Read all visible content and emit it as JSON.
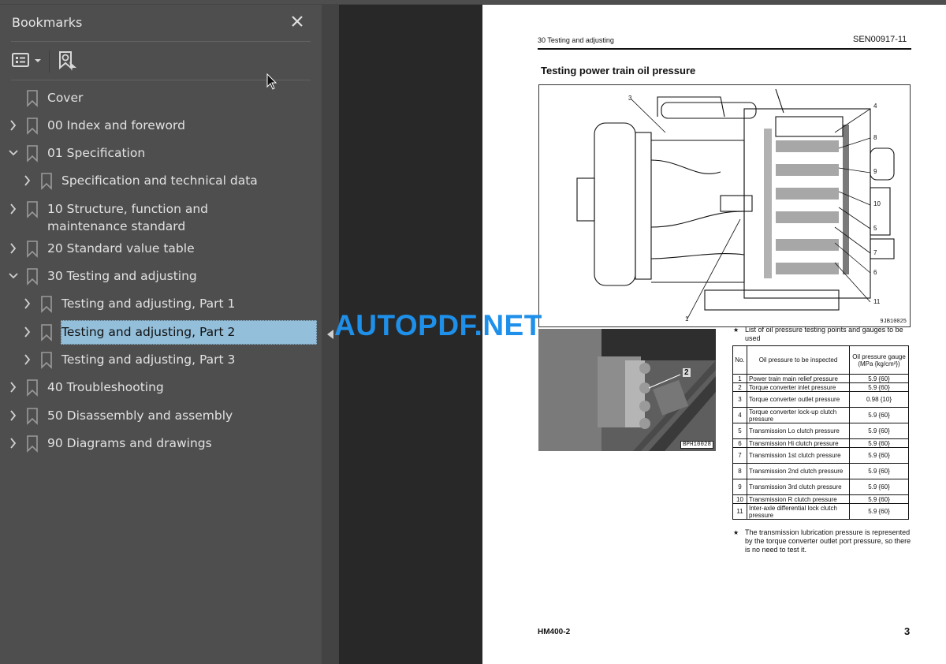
{
  "bookmarks_panel": {
    "title": "Bookmarks",
    "close_label": "close",
    "toolbar": {
      "options_icon": "list-options-icon",
      "find_current_icon": "find-current-bookmark-icon"
    },
    "items": [
      {
        "label": "Cover",
        "level": 0,
        "expander": "none"
      },
      {
        "label": "00 Index and foreword",
        "level": 0,
        "expander": "collapsed"
      },
      {
        "label": "01 Specification",
        "level": 0,
        "expander": "expanded"
      },
      {
        "label": "Specification and technical data",
        "level": 1,
        "expander": "collapsed"
      },
      {
        "label": "10 Structure, function and maintenance standard",
        "level": 0,
        "expander": "collapsed"
      },
      {
        "label": "20 Standard value table",
        "level": 0,
        "expander": "collapsed"
      },
      {
        "label": "30 Testing and adjusting",
        "level": 0,
        "expander": "expanded"
      },
      {
        "label": "Testing and adjusting, Part 1",
        "level": 1,
        "expander": "collapsed"
      },
      {
        "label": "Testing and adjusting, Part 2",
        "level": 1,
        "expander": "collapsed",
        "selected": true
      },
      {
        "label": "Testing and adjusting, Part 3",
        "level": 1,
        "expander": "collapsed"
      },
      {
        "label": "40 Troubleshooting",
        "level": 0,
        "expander": "collapsed"
      },
      {
        "label": "50 Disassembly and assembly",
        "level": 0,
        "expander": "collapsed"
      },
      {
        "label": "90 Diagrams and drawings",
        "level": 0,
        "expander": "collapsed"
      }
    ]
  },
  "watermark": "AUTOPDF.NET",
  "page": {
    "header_left": "30 Testing and adjusting",
    "header_right": "SEN00917-11",
    "title": "Testing power train oil pressure",
    "figure_code": "9JB10025",
    "figure_callouts": [
      "3",
      "4",
      "8",
      "9",
      "10",
      "5",
      "7",
      "6",
      "11",
      "1"
    ],
    "photo_code": "BPH10028",
    "photo_callout": "2",
    "list_note": "List of oil pressure testing points and gauges to be used",
    "table": {
      "headers": [
        "No.",
        "Oil pressure to be inspected",
        "Oil pressure gauge (MPa {kg/cm²})"
      ],
      "rows": [
        [
          "1",
          "Power train main relief pressure",
          "5.9 {60}"
        ],
        [
          "2",
          "Torque converter inlet pressure",
          "5.9 {60}"
        ],
        [
          "3",
          "Torque converter outlet pressure",
          "0.98 {10}"
        ],
        [
          "4",
          "Torque converter lock-up clutch pressure",
          "5.9 {60}"
        ],
        [
          "5",
          "Transmission Lo clutch pressure",
          "5.9 {60}"
        ],
        [
          "6",
          "Transmission Hi clutch pressure",
          "5.9 {60}"
        ],
        [
          "7",
          "Transmission 1st clutch pressure",
          "5.9 {60}"
        ],
        [
          "8",
          "Transmission 2nd clutch pressure",
          "5.9 {60}"
        ],
        [
          "9",
          "Transmission 3rd clutch pressure",
          "5.9 {60}"
        ],
        [
          "10",
          "Transmission R clutch pressure",
          "5.9 {60}"
        ],
        [
          "11",
          "Inter-axle differential lock clutch pressure",
          "5.9 {60}"
        ]
      ]
    },
    "bottom_note": "The transmission lubrication pressure is represented by the torque converter outlet port pressure, so there is no need to test it.",
    "footer_left": "HM400-2",
    "page_number": "3"
  }
}
